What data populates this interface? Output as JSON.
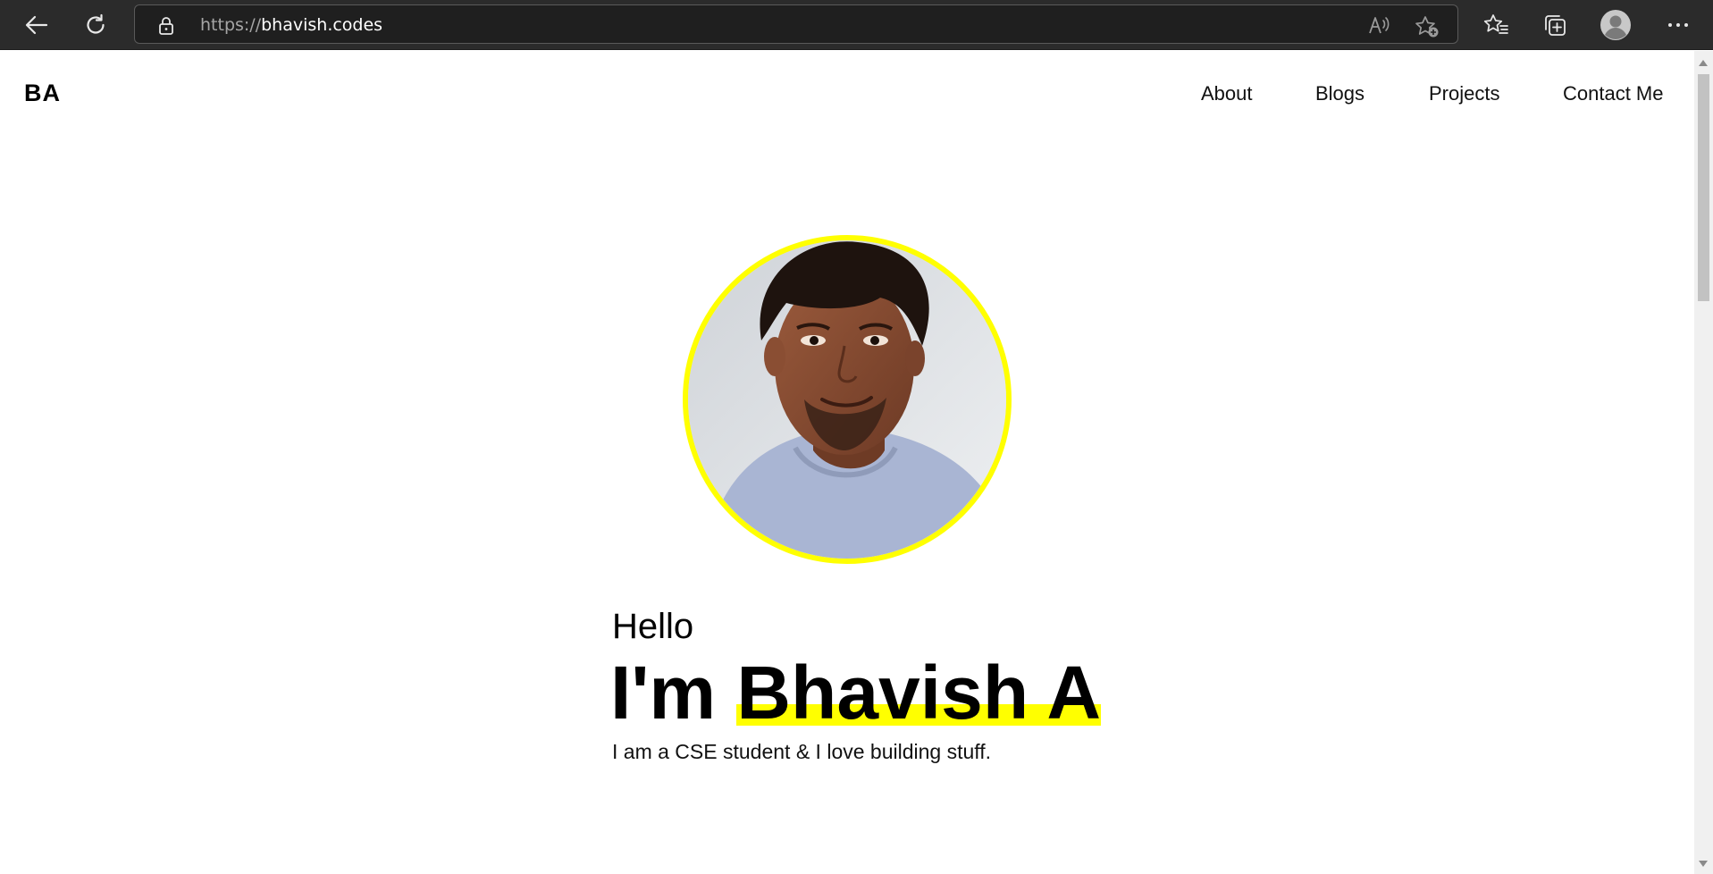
{
  "browser": {
    "url_protocol": "https://",
    "url_host": "bhavish.codes"
  },
  "site": {
    "logo": "BA",
    "nav": [
      "About",
      "Blogs",
      "Projects",
      "Contact Me"
    ]
  },
  "hero": {
    "greeting": "Hello",
    "intro_prefix": "I'm",
    "name": "Bhavish A",
    "tagline": "I am a CSE student & I love building stuff."
  },
  "colors": {
    "chrome_bg": "#2b2b2b",
    "accent_highlight": "#ffff00",
    "text": "#000000"
  },
  "icons": [
    "back-icon",
    "refresh-icon",
    "lock-icon",
    "read-aloud-icon",
    "add-favorite-icon",
    "favorites-icon",
    "collections-icon",
    "profile-icon",
    "more-icon"
  ]
}
